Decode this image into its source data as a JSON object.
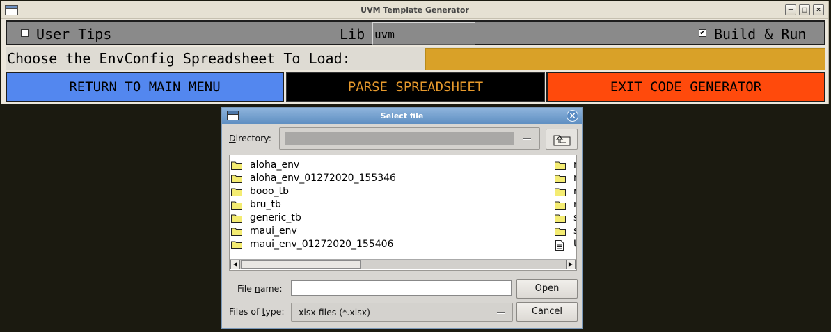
{
  "main_window": {
    "title": "UVM Template Generator",
    "minimize_glyph": "–",
    "maximize_glyph": "□",
    "close_glyph": "×",
    "user_tips": {
      "label": "User Tips",
      "checked": false
    },
    "lib": {
      "label": "Lib",
      "value": "uvm"
    },
    "build_run": {
      "label": "Build & Run",
      "checked": true,
      "check_glyph": "✔"
    },
    "choose_label": "Choose the EnvConfig Spreadsheet To Load:",
    "choose_value": "",
    "buttons": {
      "return": "RETURN TO MAIN MENU",
      "parse": "PARSE SPREADSHEET",
      "exit": "EXIT CODE GENERATOR"
    },
    "colors": {
      "return_bg": "#5387ef",
      "parse_bg": "#000000",
      "parse_fg": "#e79a2d",
      "exit_bg": "#ff4a0c",
      "choose_field_bg": "#d9a128"
    }
  },
  "dialog": {
    "title": "Select file",
    "close_glyph": "×",
    "directory": {
      "label_prefix": "",
      "label_mnemonic": "D",
      "label_rest": "irectory:",
      "value": ""
    },
    "files_left": [
      {
        "name": "aloha_env",
        "icon": "folder-icon"
      },
      {
        "name": "aloha_env_01272020_155346",
        "icon": "folder-icon"
      },
      {
        "name": "booo_tb",
        "icon": "folder-icon"
      },
      {
        "name": "bru_tb",
        "icon": "folder-icon"
      },
      {
        "name": "generic_tb",
        "icon": "folder-icon"
      },
      {
        "name": "maui_env",
        "icon": "folder-icon"
      },
      {
        "name": "maui_env_01272020_155406",
        "icon": "folder-icon"
      }
    ],
    "files_right": [
      {
        "name": "r",
        "icon": "folder-icon"
      },
      {
        "name": "r",
        "icon": "folder-icon"
      },
      {
        "name": "r",
        "icon": "folder-icon"
      },
      {
        "name": "r",
        "icon": "folder-icon"
      },
      {
        "name": "s",
        "icon": "folder-icon"
      },
      {
        "name": "s",
        "icon": "folder-icon"
      },
      {
        "name": "U",
        "icon": "file-icon"
      }
    ],
    "file_name": {
      "label_prefix": "File ",
      "label_mnemonic": "n",
      "label_rest": "ame:",
      "value": ""
    },
    "files_of_type": {
      "label_prefix": "Files of ",
      "label_mnemonic": "t",
      "label_rest": "ype:",
      "value": "xlsx files (*.xlsx)"
    },
    "open": {
      "mnemonic": "O",
      "rest": "pen"
    },
    "cancel": {
      "mnemonic": "C",
      "rest": "ancel"
    }
  }
}
